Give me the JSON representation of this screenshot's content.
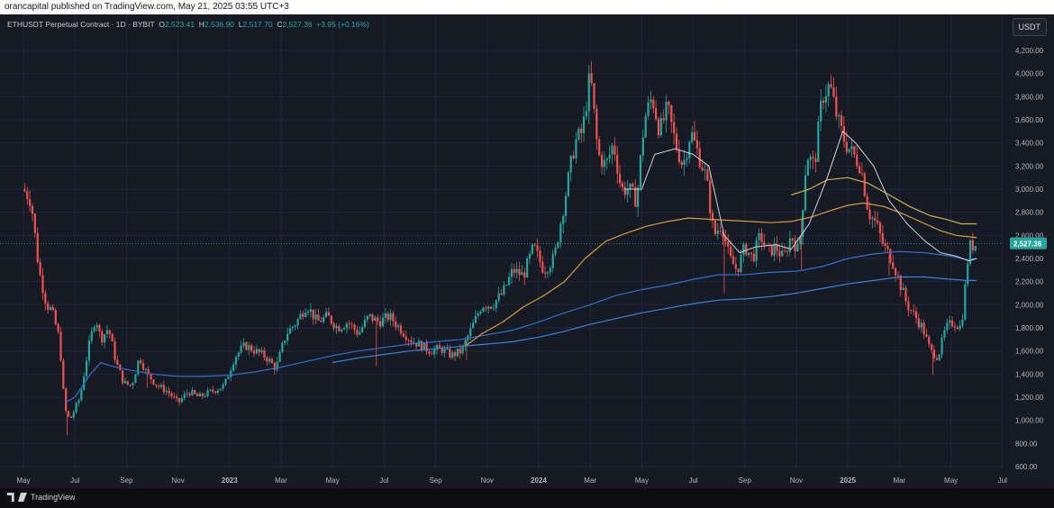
{
  "header": {
    "published_text": "orancapital published on TradingView.com, May 21, 2025 03:55 UTC+3"
  },
  "legend": {
    "symbol": "ETHUSDT Perpetual Contract · 1D · BYBIT",
    "open_label": "O",
    "open": "2,523.41",
    "high_label": "H",
    "high": "2,536.90",
    "low_label": "L",
    "low": "2,517.70",
    "close_label": "C",
    "close": "2,527.36",
    "change": "+3.95 (+0.16%)"
  },
  "currency_button": "USDT",
  "footer": {
    "brand": "TradingView"
  },
  "chart_data": {
    "type": "candlestick",
    "colors": {
      "up": "#26a69a",
      "down": "#ef5350",
      "price_tag": "#26a69a",
      "grid": "#232632",
      "ma_white": "#d1d4dc",
      "ma_yellow": "#c9b74a",
      "ma_orange": "#d89c3a",
      "ma_blue": "#2e6fd1",
      "ma_blue2": "#3d7fd9"
    },
    "last_price": "2,527.36",
    "y_ticks": [
      "4,200.00",
      "4,000.00",
      "3,800.00",
      "3,600.00",
      "3,400.00",
      "3,200.00",
      "3,000.00",
      "2,800.00",
      "2,600.00",
      "2,400.00",
      "2,200.00",
      "2,000.00",
      "1,800.00",
      "1,600.00",
      "1,400.00",
      "1,200.00",
      "1,000.00",
      "800.00",
      "600.00"
    ],
    "y_tick_values": [
      4200,
      4000,
      3800,
      3600,
      3400,
      3200,
      3000,
      2800,
      2600,
      2400,
      2200,
      2000,
      1800,
      1600,
      1400,
      1200,
      1000,
      800,
      600
    ],
    "ylim": [
      600,
      4300
    ],
    "x_ticks": [
      "May",
      "Jul",
      "Sep",
      "Nov",
      "2023",
      "Mar",
      "May",
      "Jul",
      "Sep",
      "Nov",
      "2024",
      "Mar",
      "May",
      "Jul",
      "Sep",
      "Nov",
      "2025",
      "Mar",
      "May",
      "Jul"
    ],
    "x_tick_months": [
      0,
      2,
      4,
      6,
      8,
      10,
      12,
      14,
      16,
      18,
      20,
      22,
      24,
      26,
      28,
      30,
      32,
      34,
      36,
      38
    ],
    "x_start": "2022-05",
    "price_path": [
      [
        0,
        3000
      ],
      [
        0.3,
        2900
      ],
      [
        0.6,
        2300
      ],
      [
        0.9,
        2000
      ],
      [
        1.1,
        1950
      ],
      [
        1.4,
        1700
      ],
      [
        1.6,
        1100
      ],
      [
        1.8,
        1000
      ],
      [
        2.0,
        1100
      ],
      [
        2.2,
        1200
      ],
      [
        2.5,
        1600
      ],
      [
        2.8,
        1900
      ],
      [
        3.0,
        1700
      ],
      [
        3.3,
        1800
      ],
      [
        3.6,
        1500
      ],
      [
        3.9,
        1320
      ],
      [
        4.2,
        1300
      ],
      [
        4.5,
        1550
      ],
      [
        4.8,
        1400
      ],
      [
        5.2,
        1300
      ],
      [
        5.6,
        1250
      ],
      [
        6.0,
        1150
      ],
      [
        6.4,
        1250
      ],
      [
        6.8,
        1200
      ],
      [
        7.3,
        1250
      ],
      [
        7.8,
        1300
      ],
      [
        8.2,
        1550
      ],
      [
        8.6,
        1650
      ],
      [
        9.0,
        1600
      ],
      [
        9.4,
        1550
      ],
      [
        9.8,
        1450
      ],
      [
        10.2,
        1750
      ],
      [
        10.6,
        1850
      ],
      [
        11.0,
        2000
      ],
      [
        11.4,
        1850
      ],
      [
        11.8,
        1900
      ],
      [
        12.2,
        1800
      ],
      [
        12.6,
        1850
      ],
      [
        13.0,
        1750
      ],
      [
        13.4,
        1900
      ],
      [
        13.8,
        1850
      ],
      [
        14.2,
        1900
      ],
      [
        14.6,
        1800
      ],
      [
        15.0,
        1700
      ],
      [
        15.4,
        1650
      ],
      [
        15.8,
        1600
      ],
      [
        16.2,
        1620
      ],
      [
        16.6,
        1560
      ],
      [
        17.0,
        1600
      ],
      [
        17.4,
        1800
      ],
      [
        17.8,
        2000
      ],
      [
        18.2,
        2000
      ],
      [
        18.6,
        2100
      ],
      [
        19.0,
        2300
      ],
      [
        19.4,
        2250
      ],
      [
        19.8,
        2500
      ],
      [
        20.2,
        2300
      ],
      [
        20.6,
        2400
      ],
      [
        21.0,
        2900
      ],
      [
        21.4,
        3400
      ],
      [
        21.7,
        3500
      ],
      [
        22.0,
        4000
      ],
      [
        22.3,
        3300
      ],
      [
        22.6,
        3200
      ],
      [
        22.9,
        3400
      ],
      [
        23.2,
        3000
      ],
      [
        23.5,
        3000
      ],
      [
        23.8,
        2900
      ],
      [
        24.1,
        3600
      ],
      [
        24.4,
        3800
      ],
      [
        24.7,
        3500
      ],
      [
        25.0,
        3700
      ],
      [
        25.3,
        3400
      ],
      [
        25.6,
        3200
      ],
      [
        25.9,
        3500
      ],
      [
        26.2,
        3300
      ],
      [
        26.5,
        3100
      ],
      [
        26.8,
        2600
      ],
      [
        27.1,
        2700
      ],
      [
        27.4,
        2400
      ],
      [
        27.7,
        2300
      ],
      [
        28.0,
        2500
      ],
      [
        28.3,
        2400
      ],
      [
        28.6,
        2600
      ],
      [
        28.9,
        2450
      ],
      [
        29.2,
        2500
      ],
      [
        29.5,
        2400
      ],
      [
        29.8,
        2600
      ],
      [
        30.1,
        2450
      ],
      [
        30.4,
        3300
      ],
      [
        30.7,
        3200
      ],
      [
        31.0,
        3800
      ],
      [
        31.3,
        3900
      ],
      [
        31.6,
        3600
      ],
      [
        31.9,
        3400
      ],
      [
        32.2,
        3300
      ],
      [
        32.5,
        3200
      ],
      [
        32.8,
        2800
      ],
      [
        33.1,
        2700
      ],
      [
        33.4,
        2500
      ],
      [
        33.7,
        2400
      ],
      [
        34.0,
        2200
      ],
      [
        34.3,
        2000
      ],
      [
        34.6,
        1900
      ],
      [
        34.9,
        1800
      ],
      [
        35.2,
        1600
      ],
      [
        35.5,
        1550
      ],
      [
        35.8,
        1800
      ],
      [
        36.1,
        1850
      ],
      [
        36.4,
        1800
      ],
      [
        36.7,
        2500
      ],
      [
        37.0,
        2527
      ]
    ],
    "ma_white": [
      [
        23.3,
        3000
      ],
      [
        24.0,
        3000
      ],
      [
        24.5,
        3300
      ],
      [
        25.3,
        3350
      ],
      [
        26.0,
        3300
      ],
      [
        26.6,
        3200
      ],
      [
        27.2,
        2600
      ],
      [
        27.8,
        2450
      ],
      [
        28.4,
        2500
      ],
      [
        29.2,
        2520
      ],
      [
        29.8,
        2480
      ],
      [
        30.5,
        2700
      ],
      [
        31.2,
        3100
      ],
      [
        31.8,
        3500
      ],
      [
        32.3,
        3400
      ],
      [
        33.0,
        3200
      ],
      [
        33.6,
        2900
      ],
      [
        34.3,
        2700
      ],
      [
        35.0,
        2550
      ],
      [
        35.6,
        2450
      ],
      [
        36.2,
        2420
      ],
      [
        36.7,
        2380
      ],
      [
        37.0,
        2400
      ]
    ],
    "ma_yellow": [
      [
        29.8,
        2950
      ],
      [
        30.5,
        3000
      ],
      [
        31.2,
        3080
      ],
      [
        32.0,
        3100
      ],
      [
        32.8,
        3050
      ],
      [
        33.6,
        2950
      ],
      [
        34.4,
        2850
      ],
      [
        35.2,
        2770
      ],
      [
        35.8,
        2740
      ],
      [
        36.4,
        2700
      ],
      [
        37.0,
        2700
      ]
    ],
    "ma_orange": [
      [
        17.2,
        1650
      ],
      [
        17.8,
        1750
      ],
      [
        18.6,
        1850
      ],
      [
        19.4,
        1980
      ],
      [
        20.2,
        2080
      ],
      [
        21.0,
        2200
      ],
      [
        21.8,
        2400
      ],
      [
        22.6,
        2550
      ],
      [
        23.4,
        2620
      ],
      [
        24.2,
        2680
      ],
      [
        25.0,
        2720
      ],
      [
        25.8,
        2750
      ],
      [
        26.6,
        2740
      ],
      [
        27.4,
        2730
      ],
      [
        28.2,
        2720
      ],
      [
        29.0,
        2710
      ],
      [
        29.8,
        2720
      ],
      [
        30.6,
        2760
      ],
      [
        31.4,
        2820
      ],
      [
        32.0,
        2860
      ],
      [
        32.6,
        2880
      ],
      [
        33.4,
        2850
      ],
      [
        34.2,
        2780
      ],
      [
        35.0,
        2700
      ],
      [
        35.6,
        2640
      ],
      [
        36.2,
        2600
      ],
      [
        37.0,
        2580
      ]
    ],
    "ma_blue": [
      [
        1.6,
        1150
      ],
      [
        2.0,
        1200
      ],
      [
        2.6,
        1400
      ],
      [
        3.0,
        1500
      ],
      [
        3.4,
        1470
      ],
      [
        4.0,
        1440
      ],
      [
        5.0,
        1400
      ],
      [
        6.0,
        1380
      ],
      [
        7.0,
        1380
      ],
      [
        8.0,
        1390
      ],
      [
        9.0,
        1420
      ],
      [
        10.0,
        1460
      ],
      [
        11.0,
        1510
      ],
      [
        12.0,
        1560
      ],
      [
        13.0,
        1600
      ],
      [
        14.0,
        1630
      ],
      [
        15.0,
        1660
      ],
      [
        16.0,
        1680
      ],
      [
        17.0,
        1700
      ],
      [
        18.0,
        1740
      ],
      [
        19.0,
        1780
      ],
      [
        20.0,
        1850
      ],
      [
        21.0,
        1930
      ],
      [
        22.0,
        2000
      ],
      [
        23.0,
        2080
      ],
      [
        24.0,
        2130
      ],
      [
        25.0,
        2170
      ],
      [
        26.0,
        2220
      ],
      [
        27.0,
        2260
      ],
      [
        28.0,
        2260
      ],
      [
        29.0,
        2280
      ],
      [
        30.0,
        2290
      ],
      [
        31.0,
        2330
      ],
      [
        32.0,
        2400
      ],
      [
        33.0,
        2440
      ],
      [
        34.0,
        2460
      ],
      [
        35.0,
        2450
      ],
      [
        36.0,
        2420
      ],
      [
        36.6,
        2390
      ],
      [
        37.0,
        2400
      ]
    ],
    "ma_blue2": [
      [
        12.0,
        1500
      ],
      [
        13.0,
        1540
      ],
      [
        14.0,
        1570
      ],
      [
        15.0,
        1600
      ],
      [
        16.0,
        1620
      ],
      [
        17.0,
        1640
      ],
      [
        18.0,
        1660
      ],
      [
        19.0,
        1680
      ],
      [
        20.0,
        1720
      ],
      [
        21.0,
        1770
      ],
      [
        22.0,
        1830
      ],
      [
        23.0,
        1880
      ],
      [
        24.0,
        1930
      ],
      [
        25.0,
        1970
      ],
      [
        26.0,
        2010
      ],
      [
        27.0,
        2040
      ],
      [
        28.0,
        2050
      ],
      [
        29.0,
        2070
      ],
      [
        30.0,
        2100
      ],
      [
        31.0,
        2140
      ],
      [
        32.0,
        2180
      ],
      [
        33.0,
        2210
      ],
      [
        34.0,
        2240
      ],
      [
        35.0,
        2240
      ],
      [
        36.0,
        2220
      ],
      [
        36.6,
        2210
      ],
      [
        37.0,
        2210
      ]
    ],
    "spike_low": [
      [
        1.7,
        870
      ],
      [
        4.8,
        1280
      ],
      [
        13.7,
        1470
      ],
      [
        17.2,
        1520
      ],
      [
        27.2,
        2100
      ],
      [
        30.2,
        2300
      ],
      [
        33.6,
        2250
      ],
      [
        35.3,
        1390
      ]
    ]
  }
}
